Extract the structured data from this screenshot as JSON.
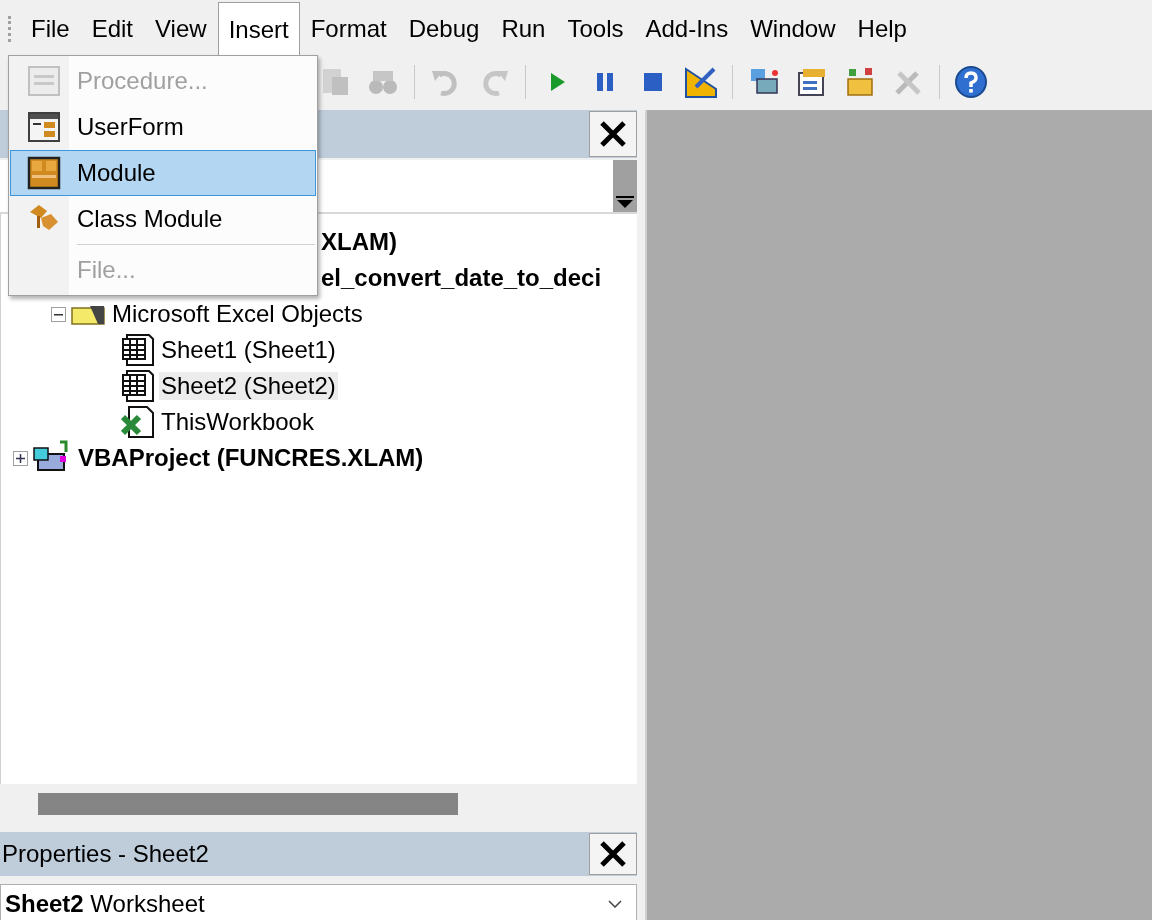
{
  "menu_bar": [
    {
      "label": "File",
      "selected": false
    },
    {
      "label": "Edit",
      "selected": false
    },
    {
      "label": "View",
      "selected": false
    },
    {
      "label": "Insert",
      "selected": true
    },
    {
      "label": "Format",
      "selected": false
    },
    {
      "label": "Debug",
      "selected": false
    },
    {
      "label": "Run",
      "selected": false
    },
    {
      "label": "Tools",
      "selected": false
    },
    {
      "label": "Add-Ins",
      "selected": false
    },
    {
      "label": "Window",
      "selected": false
    },
    {
      "label": "Help",
      "selected": false
    }
  ],
  "toolbar": [
    {
      "kind": "paste",
      "disabled": true
    },
    {
      "kind": "find",
      "disabled": true
    },
    {
      "kind": "separator"
    },
    {
      "kind": "undo",
      "disabled": true
    },
    {
      "kind": "redo",
      "disabled": true
    },
    {
      "kind": "separator"
    },
    {
      "kind": "run",
      "disabled": false
    },
    {
      "kind": "pause",
      "disabled": false
    },
    {
      "kind": "stop",
      "disabled": false
    },
    {
      "kind": "design",
      "disabled": false
    },
    {
      "kind": "separator"
    },
    {
      "kind": "explorer",
      "disabled": false
    },
    {
      "kind": "properties",
      "disabled": false
    },
    {
      "kind": "browser",
      "disabled": false
    },
    {
      "kind": "toolbox",
      "disabled": true
    },
    {
      "kind": "separator"
    },
    {
      "kind": "help",
      "disabled": false
    }
  ],
  "insert_menu": [
    {
      "kind": "item",
      "label": "Procedure...",
      "disabled": true,
      "selected": false
    },
    {
      "kind": "item",
      "label": "UserForm",
      "disabled": false,
      "selected": false
    },
    {
      "kind": "item",
      "label": "Module",
      "disabled": false,
      "selected": true
    },
    {
      "kind": "item",
      "label": "Class Module",
      "disabled": false,
      "selected": false
    },
    {
      "kind": "separator"
    },
    {
      "kind": "item",
      "label": "File...",
      "disabled": true,
      "selected": false
    }
  ],
  "project_pane": {
    "tree": [
      {
        "kind": "partial",
        "label": "XLAM)",
        "selected": false
      },
      {
        "kind": "partial",
        "label": "el_convert_date_to_deci",
        "selected": false
      },
      {
        "kind": "folder",
        "label": "Microsoft Excel Objects",
        "expanded": true,
        "selected": false,
        "children": [
          {
            "kind": "sheet",
            "label": "Sheet1 (Sheet1)",
            "selected": false
          },
          {
            "kind": "sheet",
            "label": "Sheet2 (Sheet2)",
            "selected": true
          },
          {
            "kind": "workbook",
            "label": "ThisWorkbook",
            "selected": false
          }
        ]
      },
      {
        "kind": "project",
        "label": "VBAProject (FUNCRES.XLAM)",
        "expanded": false,
        "selected": false
      }
    ]
  },
  "properties_pane": {
    "title": "Properties - Sheet2",
    "object": "**Sheet2** Worksheet"
  }
}
